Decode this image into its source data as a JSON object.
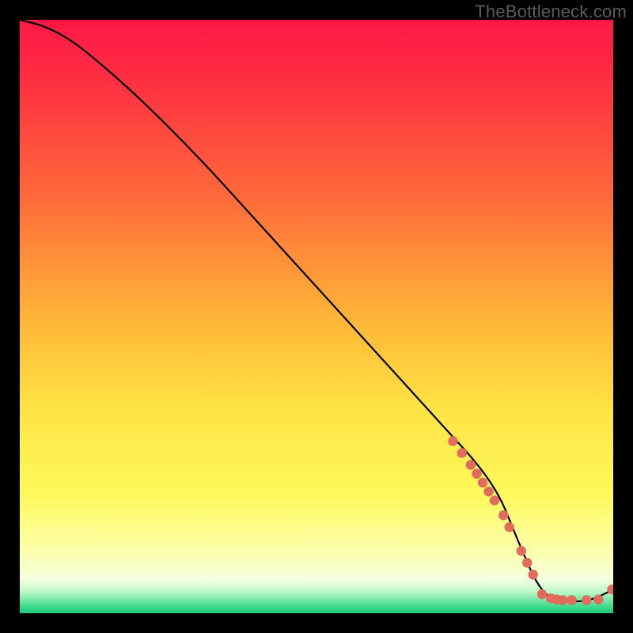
{
  "watermark": "TheBottleneck.com",
  "chart_data": {
    "type": "line",
    "title": "",
    "xlabel": "",
    "ylabel": "",
    "xlim": [
      0,
      100
    ],
    "ylim": [
      0,
      100
    ],
    "curve": {
      "x": [
        0,
        4,
        8,
        12,
        20,
        30,
        40,
        50,
        60,
        70,
        80,
        84,
        88,
        92,
        96,
        100
      ],
      "y": [
        100,
        99,
        97,
        94,
        87,
        77,
        66,
        55,
        44,
        33,
        22,
        12,
        3,
        2,
        2,
        4
      ]
    },
    "markers": {
      "x": [
        73,
        74.5,
        76,
        77,
        78,
        79,
        80,
        81.5,
        82.5,
        84.5,
        85.5,
        86.5,
        88,
        89.5,
        90.5,
        91.5,
        93,
        95.5,
        97.5,
        99.8
      ],
      "y": [
        29,
        27,
        25,
        23.5,
        22,
        20.5,
        19,
        16.5,
        14.5,
        10.5,
        8.5,
        6.5,
        3.2,
        2.5,
        2.3,
        2.2,
        2.2,
        2.2,
        2.3,
        4
      ]
    },
    "gradient_stops": [
      {
        "offset": 0.0,
        "color": "#ff1846"
      },
      {
        "offset": 0.1,
        "color": "#ff2e42"
      },
      {
        "offset": 0.3,
        "color": "#ff6a3a"
      },
      {
        "offset": 0.5,
        "color": "#ffb437"
      },
      {
        "offset": 0.65,
        "color": "#ffe244"
      },
      {
        "offset": 0.8,
        "color": "#fff95b"
      },
      {
        "offset": 0.9,
        "color": "#fcffb0"
      },
      {
        "offset": 0.945,
        "color": "#f2ffe0"
      },
      {
        "offset": 0.965,
        "color": "#b8f7c6"
      },
      {
        "offset": 0.99,
        "color": "#38d98a"
      },
      {
        "offset": 1.0,
        "color": "#1fc877"
      }
    ]
  }
}
